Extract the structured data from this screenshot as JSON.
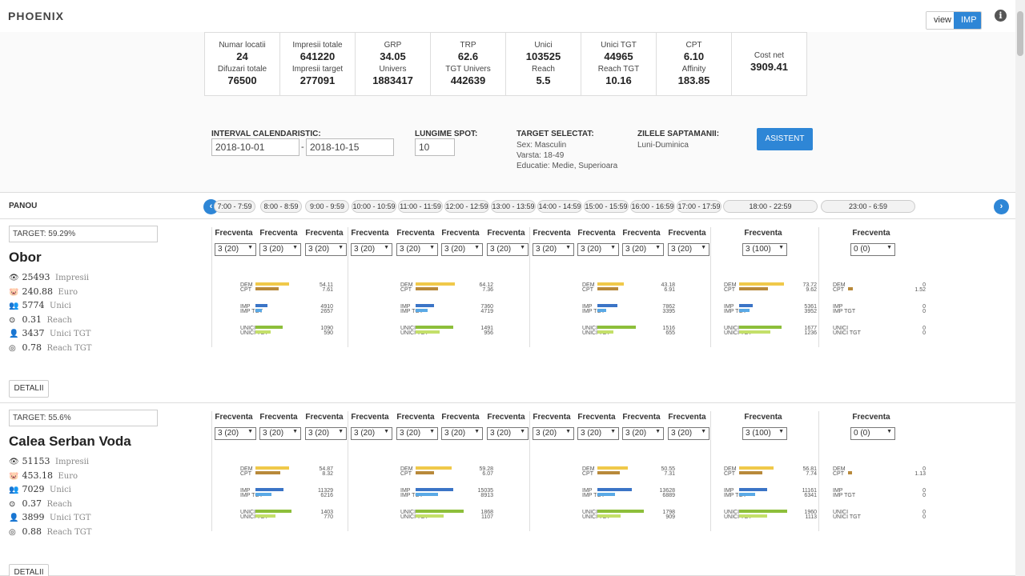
{
  "app": {
    "logo": "PHOENIX",
    "view_label": "view",
    "imp_label": "IMP"
  },
  "stats": [
    {
      "l1": "Numar locatii",
      "v1": "24",
      "l2": "Difuzari totale",
      "v2": "76500"
    },
    {
      "l1": "Impresii totale",
      "v1": "641220",
      "l2": "Impresii target",
      "v2": "277091"
    },
    {
      "l1": "GRP",
      "v1": "34.05",
      "l2": "Univers",
      "v2": "1883417"
    },
    {
      "l1": "TRP",
      "v1": "62.6",
      "l2": "TGT Univers",
      "v2": "442639"
    },
    {
      "l1": "Unici",
      "v1": "103525",
      "l2": "Reach",
      "v2": "5.5"
    },
    {
      "l1": "Unici TGT",
      "v1": "44965",
      "l2": "Reach TGT",
      "v2": "10.16"
    },
    {
      "l1": "CPT",
      "v1": "6.10",
      "l2": "Affinity",
      "v2": "183.85"
    },
    {
      "l1": "Cost net",
      "v1": "3909.41"
    }
  ],
  "filters": {
    "interval_label": "INTERVAL CALENDARISTIC:",
    "date_from": "2018-10-01",
    "date_sep": "-",
    "date_to": "2018-10-15",
    "spot_label": "LUNGIME SPOT:",
    "spot_value": "10",
    "target_label": "TARGET SELECTAT:",
    "target_lines": [
      "Sex: Masculin",
      "Varsta: 18-49",
      "Educatie: Medie, Superioara"
    ],
    "days_label": "ZILELE SAPTAMANII:",
    "days_value": "Luni-Duminica",
    "asistent": "ASISTENT"
  },
  "panou": {
    "label": "PANOU",
    "tabs": [
      "7:00 - 7:59",
      "8:00 - 8:59",
      "9:00 - 9:59",
      "10:00 - 10:59",
      "11:00 - 11:59",
      "12:00 - 12:59",
      "13:00 - 13:59",
      "14:00 - 14:59",
      "15:00 - 15:59",
      "16:00 - 16:59",
      "17:00 - 17:59",
      "18:00 - 22:59",
      "23:00 - 6:59"
    ]
  },
  "frecventa_label": "Frecventa",
  "series_labels": {
    "dem": "DEM",
    "cpt": "CPT",
    "imp": "IMP",
    "imp_tgt": "IMP TGT",
    "unici": "UNICI",
    "unici_tgt": "UNICI TGT"
  },
  "detalii_label": "DETALII",
  "colors": {
    "dem": "#f0c94a",
    "cpt": "#b8893a",
    "imp": "#3b74c6",
    "imp_tgt": "#5aa9e6",
    "unici": "#8dbf3a",
    "unici_tgt": "#c4e06a"
  },
  "locations": [
    {
      "target": "TARGET: 59.29%",
      "name": "Obor",
      "metrics": [
        {
          "icon": "eye-icon",
          "glyph": "👁",
          "v": "25493",
          "u": "Impresii"
        },
        {
          "icon": "piggy-bank-icon",
          "glyph": "🐷",
          "v": "240.88",
          "u": "Euro"
        },
        {
          "icon": "users-icon",
          "glyph": "👥",
          "v": "5774",
          "u": "Unici"
        },
        {
          "icon": "target-icon",
          "glyph": "⊙",
          "v": "0.31",
          "u": "Reach"
        },
        {
          "icon": "user-icon",
          "glyph": "👤",
          "v": "3437",
          "u": "Unici TGT"
        },
        {
          "icon": "bullseye-icon",
          "glyph": "◎",
          "v": "0.78",
          "u": "Reach TGT"
        }
      ],
      "selects": [
        "3 (20)",
        "3 (20)",
        "3 (20)",
        "3 (20)",
        "3 (20)",
        "3 (20)",
        "3 (20)",
        "3 (20)",
        "3 (20)",
        "3 (20)",
        "3 (20)",
        "3 (100)",
        "0 (0)"
      ],
      "groups": [
        {
          "dem": "54.11",
          "cpt": "7.61",
          "imp": "4910",
          "imp_tgt": "2657",
          "unici": "1090",
          "unici_tgt": "590",
          "b": [
            0.7,
            0.48,
            0.25,
            0.14,
            0.57,
            0.31
          ]
        },
        {
          "dem": "64.12",
          "cpt": "7.36",
          "imp": "7360",
          "imp_tgt": "4719",
          "unici": "1491",
          "unici_tgt": "956",
          "b": [
            0.82,
            0.46,
            0.38,
            0.25,
            0.78,
            0.5
          ]
        },
        {
          "dem": "43.18",
          "cpt": "6.91",
          "imp": "7862",
          "imp_tgt": "3395",
          "unici": "1516",
          "unici_tgt": "655",
          "b": [
            0.55,
            0.43,
            0.41,
            0.18,
            0.8,
            0.34
          ]
        },
        {
          "dem": "73.72",
          "cpt": "9.62",
          "imp": "5361",
          "imp_tgt": "3952",
          "unici": "1677",
          "unici_tgt": "1236",
          "b": [
            0.94,
            0.6,
            0.28,
            0.21,
            0.88,
            0.65
          ]
        },
        {
          "dem": "0",
          "cpt": "1.52",
          "imp": "0",
          "imp_tgt": "0",
          "unici": "0",
          "unici_tgt": "0",
          "b": [
            0,
            0.1,
            0,
            0,
            0,
            0
          ]
        }
      ]
    },
    {
      "target": "TARGET: 55.6%",
      "name": "Calea Serban Voda",
      "metrics": [
        {
          "icon": "eye-icon",
          "glyph": "👁",
          "v": "51153",
          "u": "Impresii"
        },
        {
          "icon": "piggy-bank-icon",
          "glyph": "🐷",
          "v": "453.18",
          "u": "Euro"
        },
        {
          "icon": "users-icon",
          "glyph": "👥",
          "v": "7029",
          "u": "Unici"
        },
        {
          "icon": "target-icon",
          "glyph": "⊙",
          "v": "0.37",
          "u": "Reach"
        },
        {
          "icon": "user-icon",
          "glyph": "👤",
          "v": "3899",
          "u": "Unici TGT"
        },
        {
          "icon": "bullseye-icon",
          "glyph": "◎",
          "v": "0.88",
          "u": "Reach TGT"
        }
      ],
      "selects": [
        "3 (20)",
        "3 (20)",
        "3 (20)",
        "3 (20)",
        "3 (20)",
        "3 (20)",
        "3 (20)",
        "3 (20)",
        "3 (20)",
        "3 (20)",
        "3 (20)",
        "3 (100)",
        "0 (0)"
      ],
      "groups": [
        {
          "dem": "54.87",
          "cpt": "8.32",
          "imp": "11329",
          "imp_tgt": "6216",
          "unici": "1403",
          "unici_tgt": "770",
          "b": [
            0.7,
            0.52,
            0.59,
            0.33,
            0.75,
            0.41
          ]
        },
        {
          "dem": "59.28",
          "cpt": "6.07",
          "imp": "15035",
          "imp_tgt": "8913",
          "unici": "1868",
          "unici_tgt": "1107",
          "b": [
            0.75,
            0.38,
            0.78,
            0.47,
            1.0,
            0.59
          ]
        },
        {
          "dem": "50.55",
          "cpt": "7.31",
          "imp": "13628",
          "imp_tgt": "6889",
          "unici": "1798",
          "unici_tgt": "909",
          "b": [
            0.64,
            0.46,
            0.71,
            0.36,
            0.96,
            0.48
          ]
        },
        {
          "dem": "56.81",
          "cpt": "7.74",
          "imp": "11161",
          "imp_tgt": "6341",
          "unici": "1960",
          "unici_tgt": "1113",
          "b": [
            0.72,
            0.49,
            0.58,
            0.33,
            1.0,
            0.59
          ]
        },
        {
          "dem": "0",
          "cpt": "1.13",
          "imp": "0",
          "imp_tgt": "0",
          "unici": "0",
          "unici_tgt": "0",
          "b": [
            0,
            0.08,
            0,
            0,
            0,
            0
          ]
        }
      ]
    }
  ]
}
